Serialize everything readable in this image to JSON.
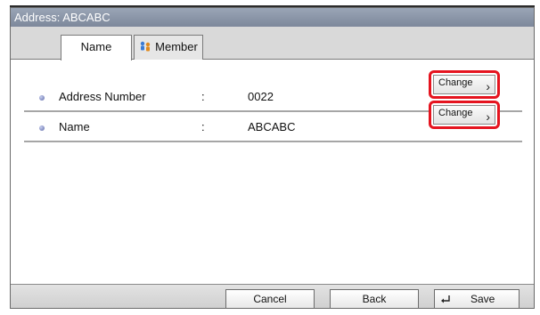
{
  "window": {
    "title": "Address: ABCABC"
  },
  "tabs": [
    {
      "label": "Name",
      "icon": ""
    },
    {
      "label": "Member",
      "icon": "group-member-icon"
    }
  ],
  "rows": [
    {
      "label": "Address Number",
      "colon": ":",
      "value": "0022",
      "button": {
        "label": "Change",
        "icon": "chevron-right-icon",
        "chevron": "›"
      }
    },
    {
      "label": "Name",
      "colon": ":",
      "value": "ABCABC",
      "button": {
        "label": "Change",
        "icon": "chevron-right-icon",
        "chevron": "›"
      }
    }
  ],
  "footer": {
    "cancel_label": "Cancel",
    "back_label": "Back",
    "save_label": "Save",
    "save_icon": "enter-key-icon"
  },
  "colors": {
    "highlight": "#e5141f",
    "titlebar": "#8a95a8"
  }
}
